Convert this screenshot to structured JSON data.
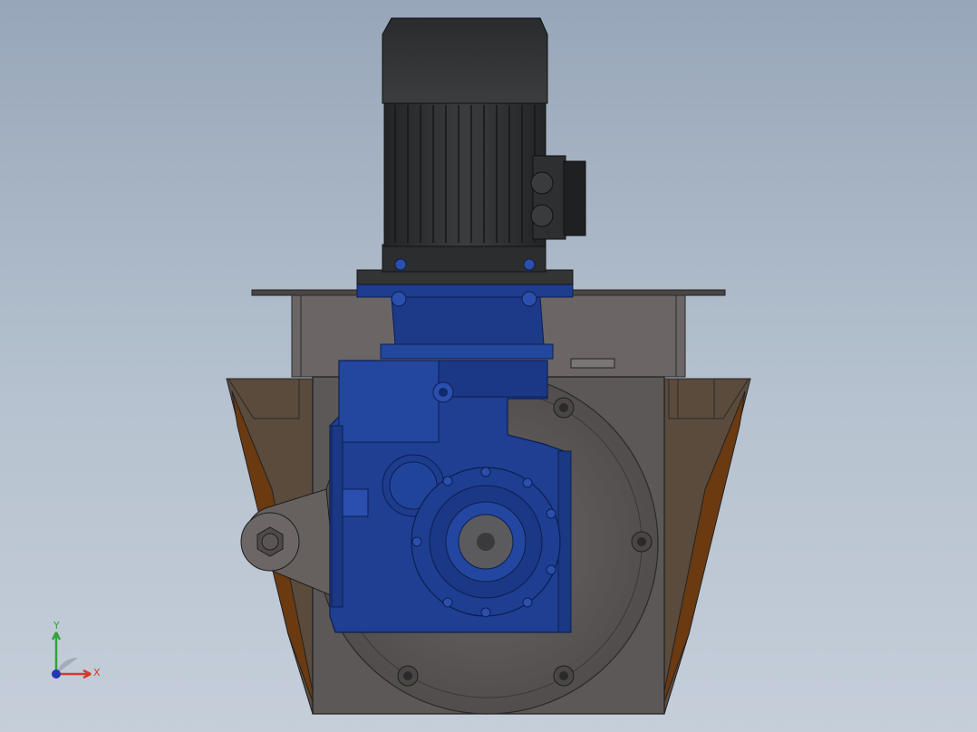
{
  "triad": {
    "x_label": "X",
    "y_label": "Y",
    "x_color": "#d43a2a",
    "y_color": "#2ea43a",
    "z_color": "#2336b8"
  },
  "colors": {
    "background_top": "#97a6b9",
    "background_bottom": "#c5ced9",
    "motor_body": "#2f3133",
    "gearbox": "#1e3d8f",
    "gearbox_dark": "#102a6e",
    "housing": "#5b5756",
    "housing_side": "#6a6564",
    "wedge": "#6b3a10"
  }
}
